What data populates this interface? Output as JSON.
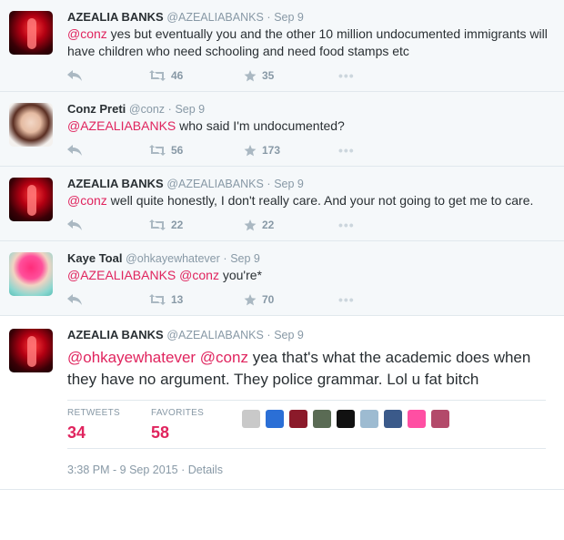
{
  "tweets": [
    {
      "name": "AZEALIA BANKS",
      "handle": "@AZEALIABANKS",
      "sep": "·",
      "date": "Sep 9",
      "text_parts": [
        {
          "type": "mention",
          "text": "@conz"
        },
        {
          "type": "text",
          "text": " yes but eventually you and the other 10 million undocumented immigrants will have children who need schooling and need food stamps etc"
        }
      ],
      "retweets": "46",
      "favorites": "35",
      "avatar": "avatar-azealia"
    },
    {
      "name": "Conz Preti",
      "handle": "@conz",
      "sep": "·",
      "date": "Sep 9",
      "text_parts": [
        {
          "type": "mention",
          "text": "@AZEALIABANKS"
        },
        {
          "type": "text",
          "text": " who said I'm undocumented?"
        }
      ],
      "retweets": "56",
      "favorites": "173",
      "avatar": "avatar-conz"
    },
    {
      "name": "AZEALIA BANKS",
      "handle": "@AZEALIABANKS",
      "sep": "·",
      "date": "Sep 9",
      "text_parts": [
        {
          "type": "mention",
          "text": "@conz"
        },
        {
          "type": "text",
          "text": " well quite honestly, I don't really care. And your not going to get me to care."
        }
      ],
      "retweets": "22",
      "favorites": "22",
      "avatar": "avatar-azealia"
    },
    {
      "name": "Kaye Toal",
      "handle": "@ohkayewhatever",
      "sep": "·",
      "date": "Sep 9",
      "text_parts": [
        {
          "type": "mention",
          "text": "@AZEALIABANKS"
        },
        {
          "type": "text",
          "text": " "
        },
        {
          "type": "mention",
          "text": "@conz"
        },
        {
          "type": "text",
          "text": " you're*"
        }
      ],
      "retweets": "13",
      "favorites": "70",
      "avatar": "avatar-kaye"
    }
  ],
  "focused": {
    "name": "AZEALIA BANKS",
    "handle": "@AZEALIABANKS",
    "sep": "·",
    "date": "Sep 9",
    "text_parts": [
      {
        "type": "mention",
        "text": "@ohkayewhatever"
      },
      {
        "type": "text",
        "text": " "
      },
      {
        "type": "mention",
        "text": "@conz"
      },
      {
        "type": "text",
        "text": " yea that's what the academic does when they have no argument. They police grammar. Lol u fat bitch"
      }
    ],
    "stats": {
      "retweets_label": "RETWEETS",
      "retweets_value": "34",
      "favorites_label": "FAVORITES",
      "favorites_value": "58"
    },
    "favoriter_colors": [
      "#c9c9c9",
      "#2b6fd6",
      "#8b1a2a",
      "#5a6b54",
      "#111111",
      "#9dbbd1",
      "#3b5a8a",
      "#ff4fa3",
      "#b34a6a"
    ],
    "timestamp": "3:38 PM - 9 Sep 2015",
    "details_sep": "·",
    "details_label": "Details"
  },
  "colors": {
    "mention": "#e0245e",
    "muted": "#8899a6",
    "stat_value": "#e0245e"
  },
  "icons": {
    "reply": "reply-icon",
    "retweet": "retweet-icon",
    "favorite": "star-icon",
    "more": "more-icon"
  }
}
